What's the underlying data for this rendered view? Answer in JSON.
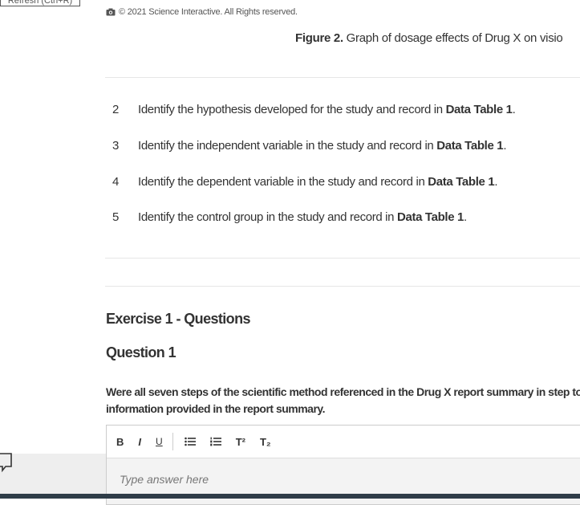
{
  "toolbar_top": {
    "refresh_label": "Refresh (Ctrl+R)"
  },
  "copyright": {
    "text": "© 2021 Science Interactive. All Rights reserved."
  },
  "figure": {
    "label": "Figure 2.",
    "caption": " Graph of dosage effects of Drug X on visio"
  },
  "steps": [
    {
      "number": "2",
      "text": "Identify the hypothesis developed for the study and record in ",
      "ref": "Data Table 1",
      "end": "."
    },
    {
      "number": "3",
      "text": "Identify the independent variable in the study and record in ",
      "ref": "Data Table 1",
      "end": "."
    },
    {
      "number": "4",
      "text": "Identify the dependent variable in the study and record in ",
      "ref": "Data Table 1",
      "end": "."
    },
    {
      "number": "5",
      "text": "Identify the control group in the study and record in ",
      "ref": "Data Table 1",
      "end": "."
    }
  ],
  "exercise": {
    "title": "Exercise 1 - Questions"
  },
  "question": {
    "title": "Question 1",
    "text": "Were all seven steps of the scientific method referenced in the Drug X report summary in step to information provided in the report summary."
  },
  "editor": {
    "bold": "B",
    "italic": "I",
    "underline": "U",
    "superscript": "T²",
    "subscript": "T₂",
    "placeholder": "Type answer here"
  },
  "colors": {
    "text": "#333333",
    "footer": "#2f3d48",
    "divider": "#e6e6e6"
  }
}
